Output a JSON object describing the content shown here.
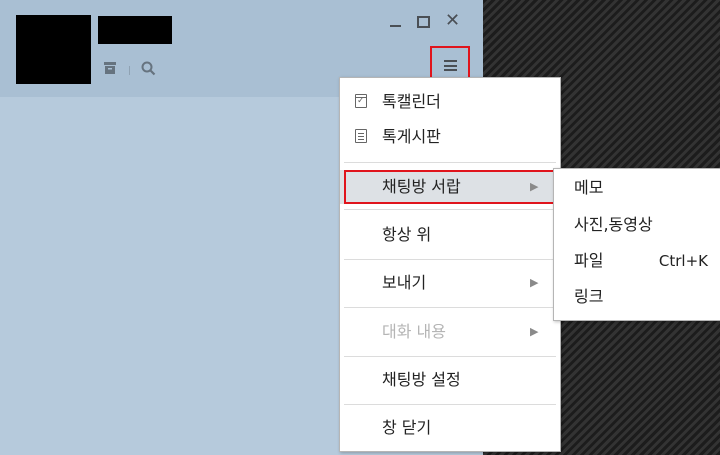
{
  "window": {
    "minimize_label": "minimize",
    "maximize_label": "maximize",
    "close_glyph": "✕"
  },
  "header": {
    "profile_image": "redacted",
    "room_name": "redacted",
    "drawer_icon": "drawer-icon",
    "search_icon": "search-icon",
    "menu_icon": "hamburger-menu-icon"
  },
  "menu": {
    "items": [
      {
        "label": "톡캘린더",
        "icon": "calendar-icon"
      },
      {
        "label": "톡게시판",
        "icon": "board-icon"
      },
      {
        "label": "채팅방 서랍",
        "has_submenu": true,
        "highlighted": true
      },
      {
        "label": "항상 위"
      },
      {
        "label": "보내기",
        "has_submenu": true
      },
      {
        "label": "대화 내용",
        "has_submenu": true,
        "disabled": true
      },
      {
        "label": "채팅방 설정"
      },
      {
        "label": "창 닫기"
      }
    ],
    "arrow_glyph": "▶"
  },
  "submenu": {
    "items": [
      {
        "label": "메모"
      },
      {
        "label": "사진,동영상"
      },
      {
        "label": "파일",
        "shortcut": "Ctrl+K"
      },
      {
        "label": "링크"
      }
    ]
  },
  "colors": {
    "highlight_border": "#e0141c",
    "window_bg": "#b6cadc",
    "header_bg": "#a9bfd3"
  }
}
